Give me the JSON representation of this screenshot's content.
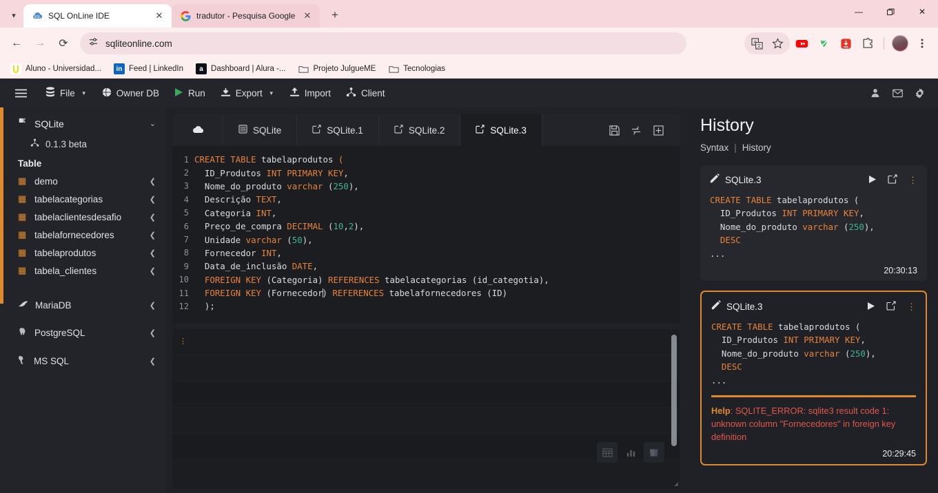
{
  "browser": {
    "tabs": [
      {
        "title": "SQL OnLine IDE",
        "favicon": "sql-cloud-icon",
        "active": true
      },
      {
        "title": "tradutor - Pesquisa Google",
        "favicon": "google-icon",
        "active": false
      }
    ],
    "new_tab_label": "+",
    "window_controls": {
      "minimize": "—",
      "maximize": "❐",
      "close": "✕"
    },
    "nav": {
      "back": "←",
      "forward": "→",
      "reload": "⟳"
    },
    "url": "sqliteonline.com",
    "omnibox_icons": [
      "page-info-icon",
      "translate-icon",
      "bookmark-star-icon"
    ],
    "extension_icons": [
      "youtube-icon",
      "adblock-icon",
      "downloader-icon",
      "extensions-puzzle-icon"
    ],
    "profile_icon": "profile-avatar",
    "menu_icon": "chrome-menu-icon",
    "bookmarks": [
      {
        "label": "Aluno - Universidad...",
        "icon": "U",
        "icon_bg": "#ffffff",
        "icon_fg": "#f5d800"
      },
      {
        "label": "Feed | LinkedIn",
        "icon": "in",
        "icon_bg": "#0a66c2",
        "icon_fg": "#ffffff"
      },
      {
        "label": "Dashboard | Alura -...",
        "icon": "a",
        "icon_bg": "#0d1117",
        "icon_fg": "#ffffff"
      },
      {
        "label": "Projeto JulgueME",
        "icon": "folder",
        "icon_bg": "transparent",
        "icon_fg": "#5f6368"
      },
      {
        "label": "Tecnologias",
        "icon": "folder",
        "icon_bg": "transparent",
        "icon_fg": "#5f6368"
      }
    ]
  },
  "app": {
    "toolbar": {
      "hamburger": "☰",
      "items": [
        {
          "label": "File",
          "icon": "database-stack-icon",
          "caret": true
        },
        {
          "label": "Owner DB",
          "icon": "globe-icon",
          "caret": false
        },
        {
          "label": "Run",
          "icon": "play-icon",
          "caret": false
        },
        {
          "label": "Export",
          "icon": "export-download-icon",
          "caret": true
        },
        {
          "label": "Import",
          "icon": "import-upload-icon",
          "caret": false
        },
        {
          "label": "Client",
          "icon": "share-nodes-icon",
          "caret": false
        }
      ],
      "right_icons": [
        "user-icon",
        "mail-icon",
        "gear-icon"
      ]
    },
    "sidebar": {
      "db_name": "SQLite",
      "db_chevron": "⌄",
      "version": "0.1.3 beta",
      "section_label": "Table",
      "tables": [
        "demo",
        "tabelacategorias",
        "tabelaclientesdesafio",
        "tabelafornecedores",
        "tabelaprodutos",
        "tabela_clientes"
      ],
      "engines": [
        {
          "label": "MariaDB",
          "icon": "mariadb-icon"
        },
        {
          "label": "PostgreSQL",
          "icon": "postgresql-elephant-icon"
        },
        {
          "label": "MS SQL",
          "icon": "mssql-icon"
        }
      ]
    },
    "editor": {
      "tabs": [
        {
          "label": "",
          "icon": "cloud-icon",
          "active": false
        },
        {
          "label": "SQLite",
          "icon": "database-icon",
          "active": false
        },
        {
          "label": "SQLite.1",
          "icon": "edit-square-icon",
          "active": false
        },
        {
          "label": "SQLite.2",
          "icon": "edit-square-icon",
          "active": false
        },
        {
          "label": "SQLite.3",
          "icon": "edit-square-icon",
          "active": true
        }
      ],
      "tools": [
        "save-floppy-icon",
        "refresh-icon",
        "add-tab-icon"
      ],
      "lines": [
        {
          "n": "1",
          "tokens": [
            {
              "t": "CREATE",
              "c": "k"
            },
            {
              "t": " ",
              "c": "pn"
            },
            {
              "t": "TABLE",
              "c": "k"
            },
            {
              "t": " tabelaprodutos ",
              "c": "pn"
            },
            {
              "t": "(",
              "c": "k"
            }
          ]
        },
        {
          "n": "2",
          "tokens": [
            {
              "t": "  ID_Produtos ",
              "c": "pn"
            },
            {
              "t": "INT",
              "c": "ty"
            },
            {
              "t": " ",
              "c": "pn"
            },
            {
              "t": "PRIMARY",
              "c": "k"
            },
            {
              "t": " ",
              "c": "pn"
            },
            {
              "t": "KEY",
              "c": "k"
            },
            {
              "t": ",",
              "c": "pn"
            }
          ]
        },
        {
          "n": "3",
          "tokens": [
            {
              "t": "  Nome_do_produto ",
              "c": "pn"
            },
            {
              "t": "varchar",
              "c": "ty"
            },
            {
              "t": " ",
              "c": "pn"
            },
            {
              "t": "(",
              "c": "pn"
            },
            {
              "t": "250",
              "c": "num"
            },
            {
              "t": "),",
              "c": "pn"
            }
          ]
        },
        {
          "n": "4",
          "tokens": [
            {
              "t": "  Descrição ",
              "c": "pn"
            },
            {
              "t": "TEXT",
              "c": "ty"
            },
            {
              "t": ",",
              "c": "pn"
            }
          ]
        },
        {
          "n": "5",
          "tokens": [
            {
              "t": "  Categoria ",
              "c": "pn"
            },
            {
              "t": "INT",
              "c": "ty"
            },
            {
              "t": ",",
              "c": "pn"
            }
          ]
        },
        {
          "n": "6",
          "tokens": [
            {
              "t": "  Preço_de_compra ",
              "c": "pn"
            },
            {
              "t": "DECIMAL",
              "c": "ty"
            },
            {
              "t": " ",
              "c": "pn"
            },
            {
              "t": "(",
              "c": "pn"
            },
            {
              "t": "10",
              "c": "num"
            },
            {
              "t": ",",
              "c": "pn"
            },
            {
              "t": "2",
              "c": "num"
            },
            {
              "t": "),",
              "c": "pn"
            }
          ]
        },
        {
          "n": "7",
          "tokens": [
            {
              "t": "  Unidade ",
              "c": "pn"
            },
            {
              "t": "varchar",
              "c": "ty"
            },
            {
              "t": " ",
              "c": "pn"
            },
            {
              "t": "(",
              "c": "pn"
            },
            {
              "t": "50",
              "c": "num"
            },
            {
              "t": "),",
              "c": "pn"
            }
          ]
        },
        {
          "n": "8",
          "tokens": [
            {
              "t": "  Fornecedor ",
              "c": "pn"
            },
            {
              "t": "INT",
              "c": "ty"
            },
            {
              "t": ",",
              "c": "pn"
            }
          ]
        },
        {
          "n": "9",
          "tokens": [
            {
              "t": "  Data_de_inclusão ",
              "c": "pn"
            },
            {
              "t": "DATE",
              "c": "ty"
            },
            {
              "t": ",",
              "c": "pn"
            }
          ]
        },
        {
          "n": "10",
          "tokens": [
            {
              "t": "  ",
              "c": "pn"
            },
            {
              "t": "FOREIGN",
              "c": "k"
            },
            {
              "t": " ",
              "c": "pn"
            },
            {
              "t": "KEY",
              "c": "k"
            },
            {
              "t": " (Categoria) ",
              "c": "pn"
            },
            {
              "t": "REFERENCES",
              "c": "k"
            },
            {
              "t": " tabelacategorias (id_categotia),",
              "c": "pn"
            }
          ]
        },
        {
          "n": "11",
          "tokens": [
            {
              "t": "  ",
              "c": "pn"
            },
            {
              "t": "FOREIGN",
              "c": "k"
            },
            {
              "t": " ",
              "c": "pn"
            },
            {
              "t": "KEY",
              "c": "k"
            },
            {
              "t": " (Fornecedor",
              "c": "pn"
            },
            {
              "t": "|CURSOR|",
              "c": "cursor"
            },
            {
              "t": ") ",
              "c": "pn"
            },
            {
              "t": "REFERENCES",
              "c": "k"
            },
            {
              "t": " tabelafornecedores (ID)",
              "c": "pn"
            }
          ]
        },
        {
          "n": "12",
          "tokens": [
            {
              "t": "  );",
              "c": "pn"
            }
          ]
        }
      ]
    },
    "result": {
      "status_icon": "vertical-dots-warning",
      "view_tools": [
        "table-grid-icon",
        "bar-chart-icon",
        "book-icon"
      ]
    },
    "history": {
      "title": "History",
      "link_syntax": "Syntax",
      "link_separator": "|",
      "link_history": "History",
      "entries": [
        {
          "name": "SQLite.3",
          "icon": "pencil-icon",
          "actions": [
            "run-play-icon",
            "edit-square-icon",
            "more-vertical-icon"
          ],
          "code_lines": [
            [
              {
                "t": "CREATE",
                "c": "k"
              },
              {
                "t": " ",
                "c": "pn"
              },
              {
                "t": "TABLE",
                "c": "k"
              },
              {
                "t": " tabelaprodutos ",
                "c": "pn"
              },
              {
                "t": "(",
                "c": "pn"
              }
            ],
            [
              {
                "t": "  ID_Produtos ",
                "c": "pn"
              },
              {
                "t": "INT",
                "c": "ty"
              },
              {
                "t": " ",
                "c": "pn"
              },
              {
                "t": "PRIMARY",
                "c": "k"
              },
              {
                "t": " ",
                "c": "pn"
              },
              {
                "t": "KEY",
                "c": "k"
              },
              {
                "t": ",",
                "c": "pn"
              }
            ],
            [
              {
                "t": "  Nome_do_produto ",
                "c": "pn"
              },
              {
                "t": "varchar",
                "c": "ty"
              },
              {
                "t": " ",
                "c": "pn"
              },
              {
                "t": "(",
                "c": "pn"
              },
              {
                "t": "250",
                "c": "num"
              },
              {
                "t": "),",
                "c": "pn"
              }
            ],
            [
              {
                "t": "  DESC",
                "c": "k"
              }
            ],
            [
              {
                "t": "...",
                "c": "pn"
              }
            ]
          ],
          "time": "20:30:13",
          "highlighted": false,
          "error": null
        },
        {
          "name": "SQLite.3",
          "icon": "pencil-icon",
          "actions": [
            "run-play-icon",
            "edit-square-icon",
            "more-vertical-icon"
          ],
          "code_lines": [
            [
              {
                "t": "CREATE",
                "c": "k"
              },
              {
                "t": " ",
                "c": "pn"
              },
              {
                "t": "TABLE",
                "c": "k"
              },
              {
                "t": " tabelaprodutos ",
                "c": "pn"
              },
              {
                "t": "(",
                "c": "pn"
              }
            ],
            [
              {
                "t": "  ID_Produtos ",
                "c": "pn"
              },
              {
                "t": "INT",
                "c": "ty"
              },
              {
                "t": " ",
                "c": "pn"
              },
              {
                "t": "PRIMARY",
                "c": "k"
              },
              {
                "t": " ",
                "c": "pn"
              },
              {
                "t": "KEY",
                "c": "k"
              },
              {
                "t": ",",
                "c": "pn"
              }
            ],
            [
              {
                "t": "  Nome_do_produto ",
                "c": "pn"
              },
              {
                "t": "varchar",
                "c": "ty"
              },
              {
                "t": " ",
                "c": "pn"
              },
              {
                "t": "(",
                "c": "pn"
              },
              {
                "t": "250",
                "c": "num"
              },
              {
                "t": "),",
                "c": "pn"
              }
            ],
            [
              {
                "t": "  DESC",
                "c": "k"
              }
            ],
            [
              {
                "t": "...",
                "c": "pn"
              }
            ]
          ],
          "time": "20:29:45",
          "highlighted": true,
          "error": {
            "label": "Help",
            "message": ": SQLITE_ERROR: sqlite3 result code 1: unknown column \"Fornecedores\" in foreign key definition"
          }
        }
      ]
    }
  },
  "colors": {
    "accent_orange": "#e08a2e",
    "error_red": "#e2574c",
    "keyword_orange": "#e8833a",
    "number_green": "#3fb68b",
    "app_bg": "#1f2126",
    "panel_bg": "#1b1d21",
    "browser_pink": "#fdeef0"
  }
}
